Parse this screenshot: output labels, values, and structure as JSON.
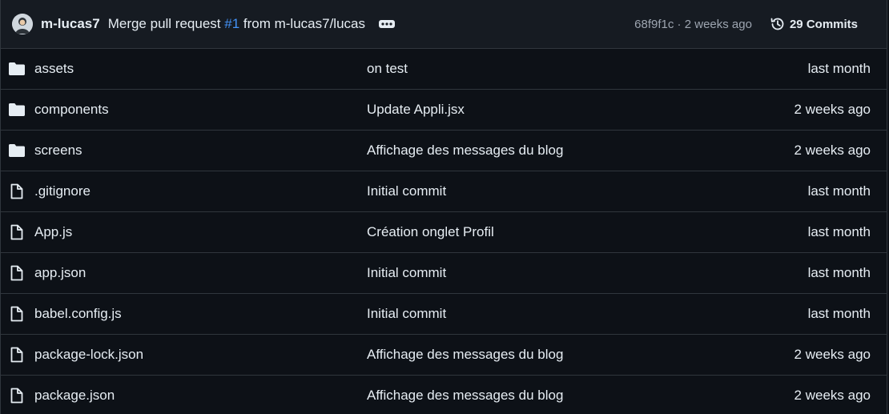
{
  "latest_commit": {
    "author": "m-lucas7",
    "message_prefix": "Merge pull request ",
    "pr_number": "#1",
    "message_suffix": " from m-lucas7/lucas",
    "sha": "68f9f1c",
    "separator": " · ",
    "age": "2 weeks ago",
    "commits_label": "29 Commits"
  },
  "files": [
    {
      "type": "folder",
      "icon": "folder-icon",
      "name": "assets",
      "message": "on test",
      "date": "last month"
    },
    {
      "type": "folder",
      "icon": "folder-icon",
      "name": "components",
      "message": "Update Appli.jsx",
      "date": "2 weeks ago"
    },
    {
      "type": "folder",
      "icon": "folder-icon",
      "name": "screens",
      "message": "Affichage des messages du blog",
      "date": "2 weeks ago"
    },
    {
      "type": "file",
      "icon": "file-icon",
      "name": ".gitignore",
      "message": "Initial commit",
      "date": "last month"
    },
    {
      "type": "file",
      "icon": "file-icon",
      "name": "App.js",
      "message": "Création onglet Profil",
      "date": "last month"
    },
    {
      "type": "file",
      "icon": "file-icon",
      "name": "app.json",
      "message": "Initial commit",
      "date": "last month"
    },
    {
      "type": "file",
      "icon": "file-icon",
      "name": "babel.config.js",
      "message": "Initial commit",
      "date": "last month"
    },
    {
      "type": "file",
      "icon": "file-icon",
      "name": "package-lock.json",
      "message": "Affichage des messages du blog",
      "date": "2 weeks ago"
    },
    {
      "type": "file",
      "icon": "file-icon",
      "name": "package.json",
      "message": "Affichage des messages du blog",
      "date": "2 weeks ago"
    }
  ],
  "colors": {
    "background": "#0d1117",
    "header_background": "#161b22",
    "border": "#30363d",
    "link": "#4493f8",
    "muted_text": "#9da5b0"
  }
}
